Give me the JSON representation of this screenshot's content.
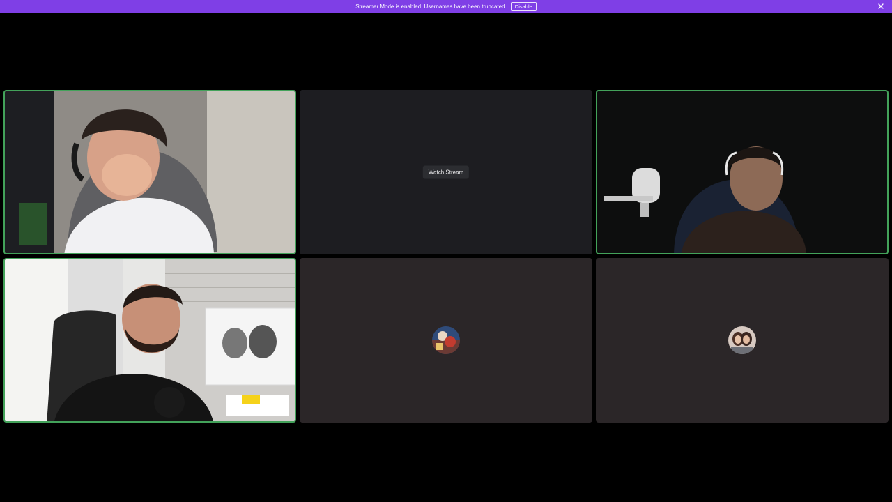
{
  "banner": {
    "message": "Streamer Mode is enabled. Usernames have been truncated.",
    "disable_label": "Disable",
    "close_icon": "close-icon",
    "color": "#7f3fe6"
  },
  "tiles": [
    {
      "kind": "video",
      "speaking": true,
      "content": "participant-video-1"
    },
    {
      "kind": "stream",
      "speaking": false,
      "watch_label": "Watch Stream"
    },
    {
      "kind": "video",
      "speaking": true,
      "content": "participant-video-2"
    },
    {
      "kind": "video",
      "speaking": true,
      "content": "participant-video-3"
    },
    {
      "kind": "avatar",
      "speaking": false,
      "content": "participant-avatar-4"
    },
    {
      "kind": "avatar",
      "speaking": false,
      "content": "participant-avatar-5"
    }
  ],
  "colors": {
    "speaking_ring": "#43a25a",
    "background": "#000000",
    "stream_tile": "#1d1d21",
    "avatar_tile": "#2b2628"
  }
}
